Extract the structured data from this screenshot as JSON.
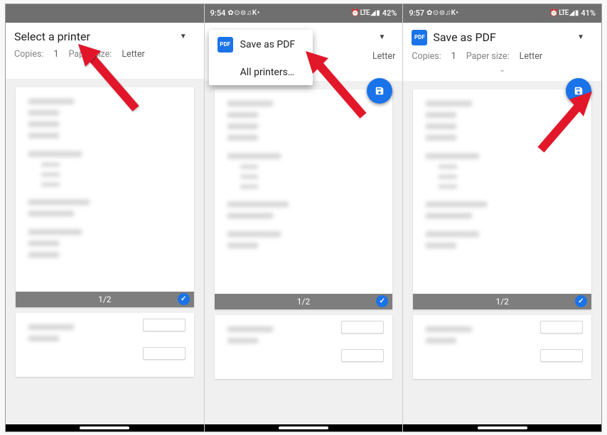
{
  "screens": [
    {
      "status": {
        "time": "",
        "icons_left": "",
        "icons_right": "",
        "battery": ""
      },
      "printer_label": "Select a printer",
      "show_pdf_icon": false,
      "copies_label": "Copies:",
      "copies_value": "1",
      "paper_label": "Paper size:",
      "paper_value": "Letter",
      "show_fab": false,
      "show_dropdown": false,
      "page_counter": "1/2",
      "arrow_target": "printer-select"
    },
    {
      "status": {
        "time": "9:54",
        "icons_left": "✿ ⊙ ⊜ ♫ K •",
        "icons_right": "⏰ LTE ◢ ▮",
        "battery": "42%"
      },
      "printer_label": "Save as PDF",
      "show_pdf_icon": true,
      "copies_label": "",
      "copies_value": "",
      "paper_label": "",
      "paper_value": "Letter",
      "show_fab": true,
      "show_dropdown": true,
      "dropdown_items": [
        {
          "label": "Save as PDF",
          "icon": "PDF"
        },
        {
          "label": "All printers…",
          "icon": ""
        }
      ],
      "page_counter": "1/2",
      "arrow_target": "dropdown-save-pdf"
    },
    {
      "status": {
        "time": "9:57",
        "icons_left": "✿ ⊙ ⊜ ♫ K •",
        "icons_right": "⏰ LTE ◢ ▮",
        "battery": "41%"
      },
      "printer_label": "Save as PDF",
      "show_pdf_icon": true,
      "copies_label": "Copies:",
      "copies_value": "1",
      "paper_label": "Paper size:",
      "paper_value": "Letter",
      "show_fab": true,
      "show_dropdown": false,
      "page_counter": "1/2",
      "arrow_target": "fab"
    }
  ]
}
